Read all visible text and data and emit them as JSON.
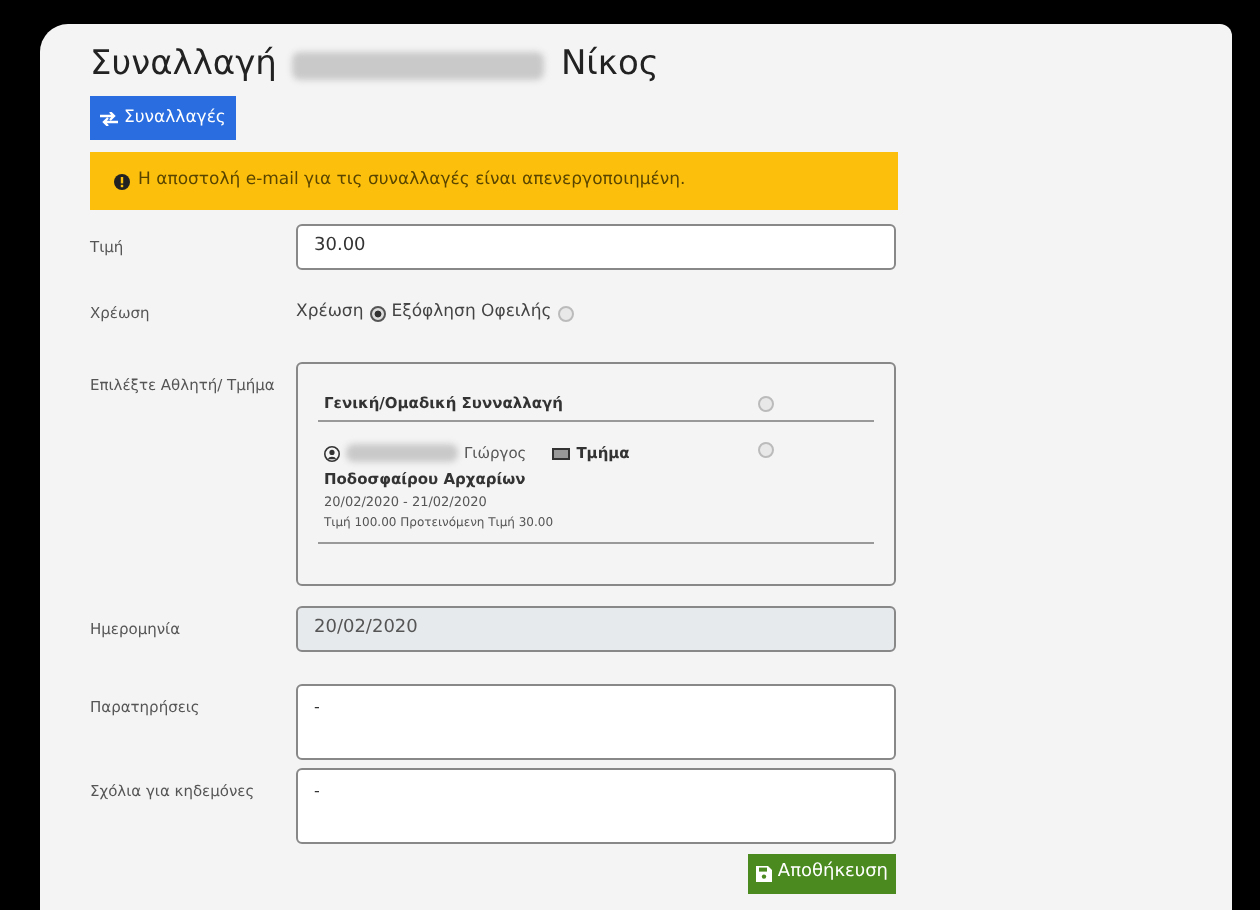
{
  "title": {
    "prefix": "Συναλλαγή",
    "suffix": "Νίκος"
  },
  "back_button": {
    "label": "Συναλλαγές"
  },
  "alert": {
    "text": "Η αποστολή e-mail για τις συναλλαγές είναι απενεργοποιημένη."
  },
  "price": {
    "label": "Τιμή",
    "value": "30.00"
  },
  "charge_type": {
    "label": "Χρέωση",
    "options": [
      {
        "label": "Χρέωση",
        "selected": true
      },
      {
        "label": "Εξόφληση Οφειλής",
        "selected": false
      }
    ]
  },
  "athlete": {
    "label": "Επιλέξτε Αθλητή/ Τμήμα",
    "options": [
      {
        "kind": "general",
        "title": "Γενική/Ομαδική Συνναλλαγή",
        "selected": false
      },
      {
        "kind": "athlete",
        "first_name": "Γιώργος",
        "group_label": "Τμήμα",
        "group_name": "Ποδοσφαίρου Αρχαρίων",
        "dates": "20/02/2020 - 21/02/2020",
        "prices": "Τιμή 100.00 Προτεινόμενη Τιμή 30.00",
        "selected": false
      }
    ]
  },
  "date": {
    "label": "Ημερομηνία",
    "value": "20/02/2020",
    "disabled": true
  },
  "notes": {
    "label": "Παρατηρήσεις",
    "value": "-"
  },
  "guardian_comments": {
    "label": "Σχόλια για κηδεμόνες",
    "value": "-"
  },
  "save_button": {
    "label": "Αποθήκευση"
  }
}
